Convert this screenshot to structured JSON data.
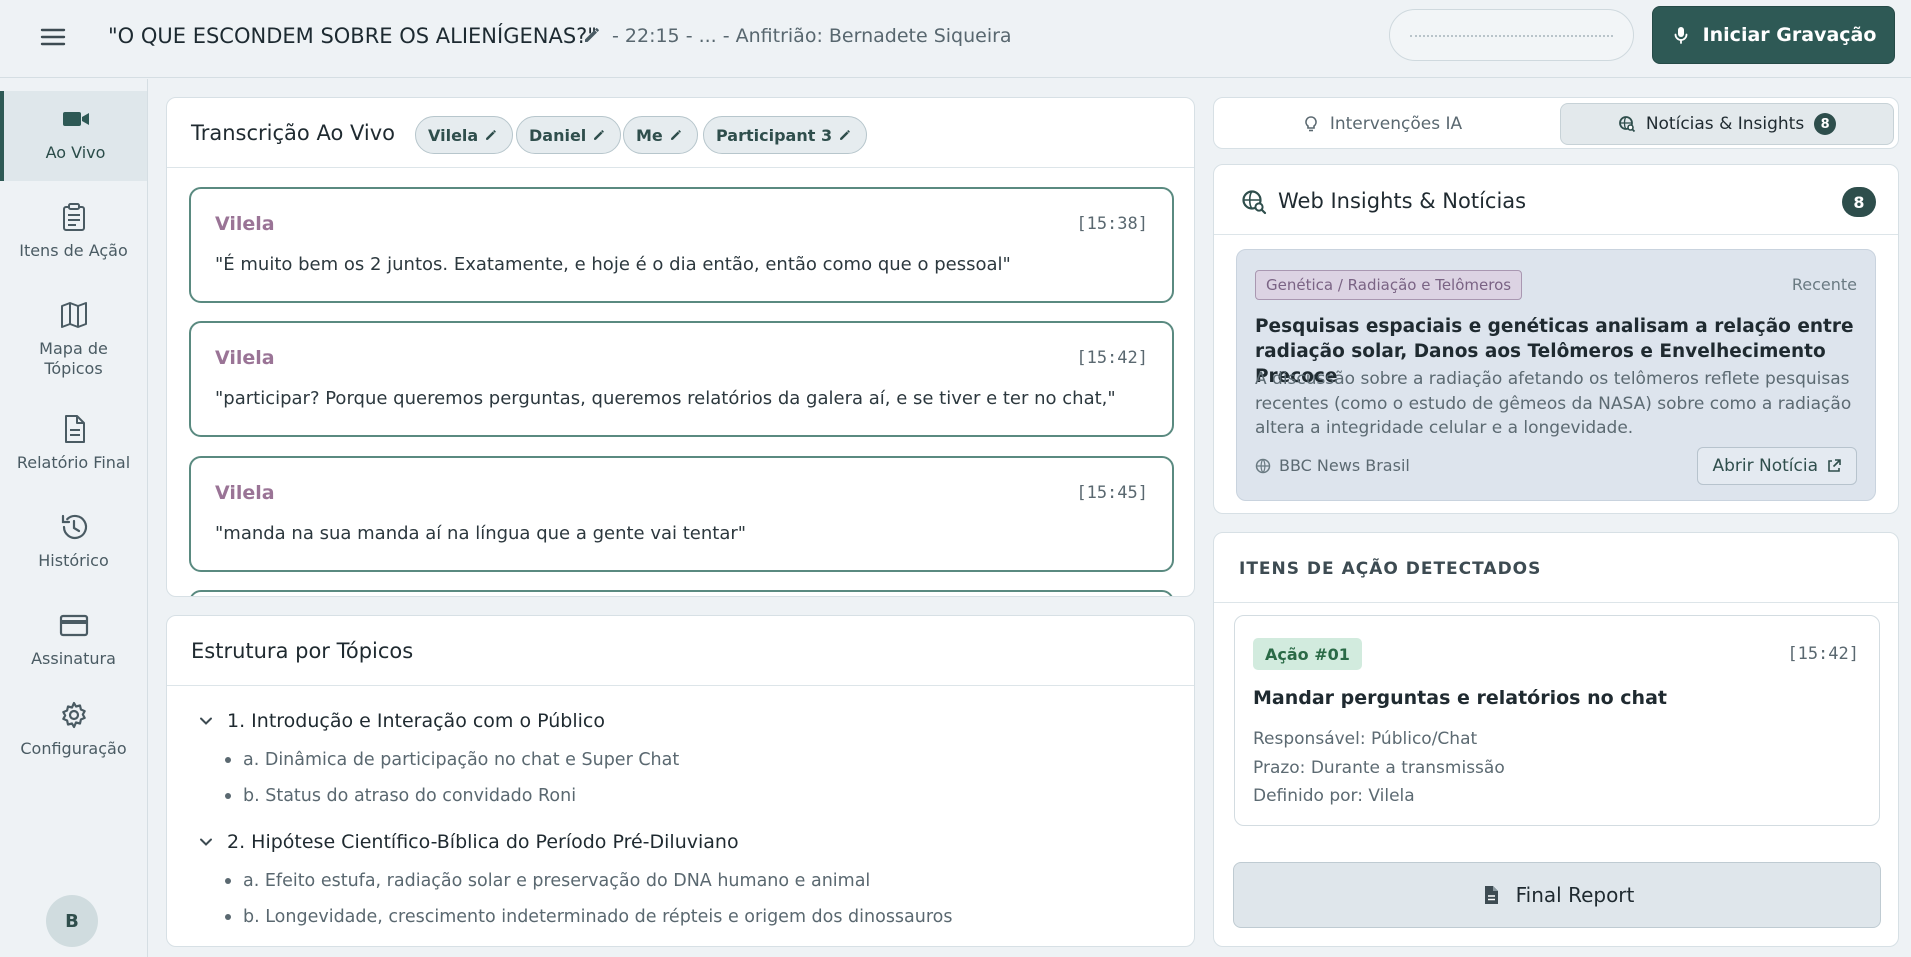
{
  "header": {
    "title": "\"O QUE ESCONDEM SOBRE OS ALIENÍGENAS?\"",
    "meta": "- 22:15 - ... - Anfitrião: Bernadete Siqueira",
    "record_label": "Iniciar Gravação"
  },
  "sidebar": {
    "items": [
      {
        "label": "Ao Vivo",
        "icon": "video-icon",
        "active": true
      },
      {
        "label": "Itens de Ação",
        "icon": "clipboard-icon"
      },
      {
        "label": "Mapa de Tópicos",
        "icon": "map-icon"
      },
      {
        "label": "Relatório Final",
        "icon": "document-icon"
      },
      {
        "label": "Histórico",
        "icon": "history-icon"
      },
      {
        "label": "Assinatura",
        "icon": "credit-card-icon"
      },
      {
        "label": "Configuração",
        "icon": "gear-icon"
      }
    ],
    "avatar_initial": "B"
  },
  "transcript": {
    "title": "Transcrição Ao Vivo",
    "participants": [
      "Vilela",
      "Daniel",
      "Me",
      "Participant 3"
    ],
    "messages": [
      {
        "speaker": "Vilela",
        "time": "[15:38]",
        "text": "\"É muito bem os 2 juntos. Exatamente, e hoje é o dia então, então como que o pessoal\""
      },
      {
        "speaker": "Vilela",
        "time": "[15:42]",
        "text": "\"participar? Porque queremos perguntas, queremos relatórios da galera aí, e se tiver e ter no chat,\""
      },
      {
        "speaker": "Vilela",
        "time": "[15:45]",
        "text": "\"manda na sua manda aí na língua que a gente vai tentar\""
      }
    ]
  },
  "topics": {
    "title": "Estrutura por Tópicos",
    "sections": [
      {
        "label": "1. Introdução e Interação com o Público",
        "items": [
          "a. Dinâmica de participação no chat e Super Chat",
          "b. Status do atraso do convidado Roni"
        ]
      },
      {
        "label": "2. Hipótese Científico-Bíblica do Período Pré-Diluviano",
        "items": [
          "a. Efeito estufa, radiação solar e preservação do DNA humano e animal",
          "b. Longevidade, crescimento indeterminado de répteis e origem dos dinossauros"
        ]
      }
    ]
  },
  "tabs": {
    "ia_label": "Intervenções IA",
    "news_label": "Notícias & Insights",
    "news_count": "8"
  },
  "insights": {
    "title": "Web Insights & Notícias",
    "count": "8",
    "news": {
      "tag": "Genética / Radiação e Telômeros",
      "recency": "Recente",
      "headline": "Pesquisas espaciais e genéticas analisam a relação entre radiação solar, Danos aos Telômeros e Envelhecimento Precoce",
      "body": "A discussão sobre a radiação afetando os telômeros reflete pesquisas recentes (como o estudo de gêmeos da NASA) sobre como a radiação altera a integridade celular e a longevidade.",
      "source": "BBC News Brasil",
      "open_label": "Abrir Notícia"
    }
  },
  "actions": {
    "title": "ITENS DE AÇÃO DETECTADOS",
    "item": {
      "badge": "Ação #01",
      "time": "[15:42]",
      "headline": "Mandar perguntas e relatórios no chat",
      "owner": "Responsável: Público/Chat",
      "deadline": "Prazo: Durante a transmissão",
      "defined_by": "Definido por: Vilela"
    },
    "final_report_label": "Final Report"
  },
  "colors": {
    "accent": "#2e5955",
    "speaker": "#9a7496",
    "action_badge_bg": "#d2ebde"
  }
}
